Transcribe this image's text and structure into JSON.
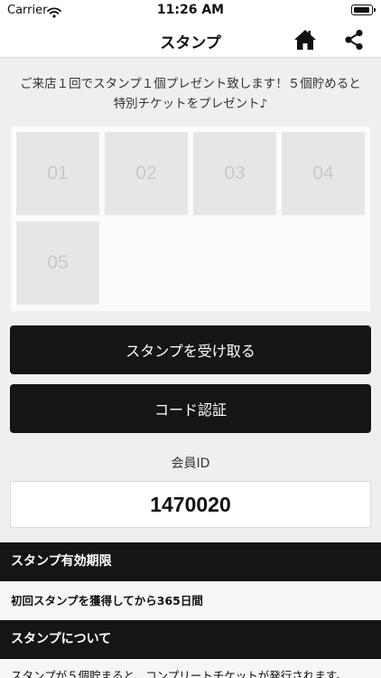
{
  "status_bar": {
    "carrier": "Carrier",
    "time": "11:26 AM"
  },
  "nav": {
    "title": "スタンプ",
    "home_icon": "home-icon",
    "share_icon": "share-icon"
  },
  "intro": {
    "line1": "ご来店１回でスタンプ１個プレゼント致します！５個貯めると",
    "line2": "特別チケットをプレゼント♪"
  },
  "stamps": [
    "01",
    "02",
    "03",
    "04",
    "05"
  ],
  "buttons": {
    "receive_label": "スタンプを受け取る",
    "code_label": "コード認証"
  },
  "member": {
    "label": "会員ID",
    "id": "1470020"
  },
  "sections": {
    "validity": {
      "title": "スタンプ有効期限",
      "body": "初回スタンプを獲得してから365日間"
    },
    "about": {
      "title": "スタンプについて",
      "body": "スタンプが５個貯まると、コンプリートチケットが発行されます。"
    }
  },
  "colors": {
    "primary": "#151515",
    "background": "#efefef",
    "stamp_empty": "#e6e6e6"
  }
}
